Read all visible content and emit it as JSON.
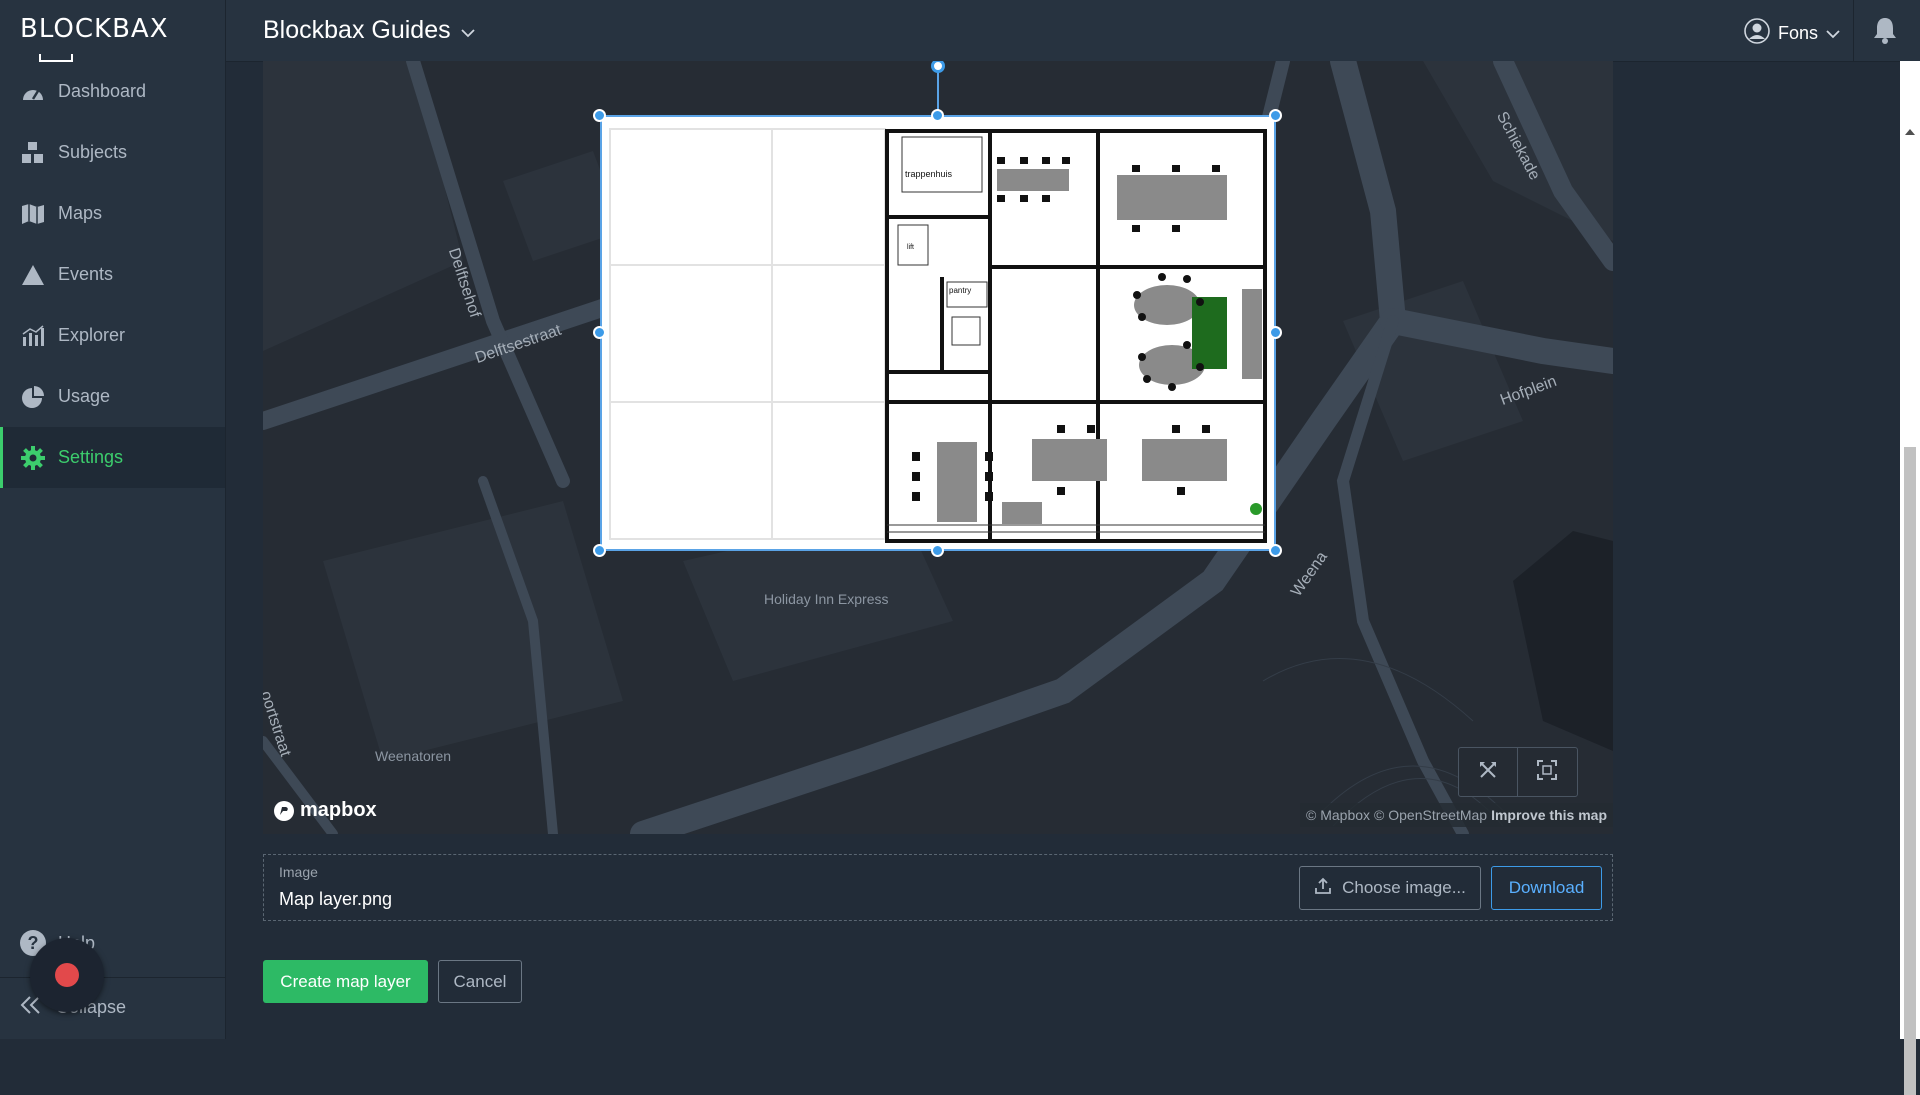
{
  "app": {
    "logo": "BLOCKBAX",
    "org_name": "Blockbax Guides"
  },
  "sidebar": {
    "items": [
      {
        "label": "Dashboard",
        "icon": "dashboard-icon"
      },
      {
        "label": "Subjects",
        "icon": "subjects-icon"
      },
      {
        "label": "Maps",
        "icon": "map-icon"
      },
      {
        "label": "Events",
        "icon": "warning-icon"
      },
      {
        "label": "Explorer",
        "icon": "chart-icon"
      },
      {
        "label": "Usage",
        "icon": "pie-icon"
      },
      {
        "label": "Settings",
        "icon": "gear-icon",
        "active": true
      }
    ],
    "help_label": "Help",
    "collapse_label": "Collapse"
  },
  "header": {
    "user_name": "Fons"
  },
  "map": {
    "street_labels": [
      "Delftsehof",
      "Delftsestraat",
      "Schiekade",
      "Hofplein",
      "Weena",
      "oortstraat"
    ],
    "poi_labels": [
      "Holiday Inn Express",
      "Weenatoren"
    ],
    "floorplan_labels": [
      "trappenhuis",
      "lift",
      "pantry"
    ],
    "logo": "mapbox",
    "attribution": {
      "mapbox": "© Mapbox",
      "osm": "© OpenStreetMap",
      "improve": "Improve this map"
    }
  },
  "image_field": {
    "label": "Image",
    "value": "Map layer.png",
    "choose_label": "Choose image...",
    "download_label": "Download"
  },
  "actions": {
    "create_label": "Create map layer",
    "cancel_label": "Cancel"
  },
  "colors": {
    "accent": "#2dba65",
    "link": "#3d9be8",
    "sidebar_bg": "#273340"
  }
}
